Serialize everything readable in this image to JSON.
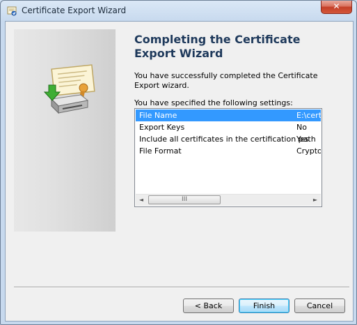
{
  "window": {
    "title": "Certificate Export Wizard",
    "close_symbol": "✕"
  },
  "page": {
    "heading": "Completing the Certificate Export Wizard",
    "intro": "You have successfully completed the Certificate Export wizard.",
    "settings_label": "You have specified the following settings:"
  },
  "settings": {
    "rows": [
      {
        "name": "File Name",
        "value": "E:\\certif",
        "selected": true
      },
      {
        "name": "Export Keys",
        "value": "No",
        "selected": false
      },
      {
        "name": "Include all certificates in the certification path",
        "value": "Yes",
        "selected": false
      },
      {
        "name": "File Format",
        "value": "Cryptog",
        "selected": false
      }
    ]
  },
  "scrollbar": {
    "left_arrow": "◄",
    "right_arrow": "►",
    "grip": "III"
  },
  "buttons": {
    "back": "< Back",
    "finish": "Finish",
    "cancel": "Cancel"
  },
  "colors": {
    "selection": "#3399ff",
    "heading": "#1e395b",
    "close_button": "#c44028"
  },
  "icons": {
    "title": "certificate-wizard-icon",
    "wizard_art": "certificate-export-disk-icon"
  }
}
